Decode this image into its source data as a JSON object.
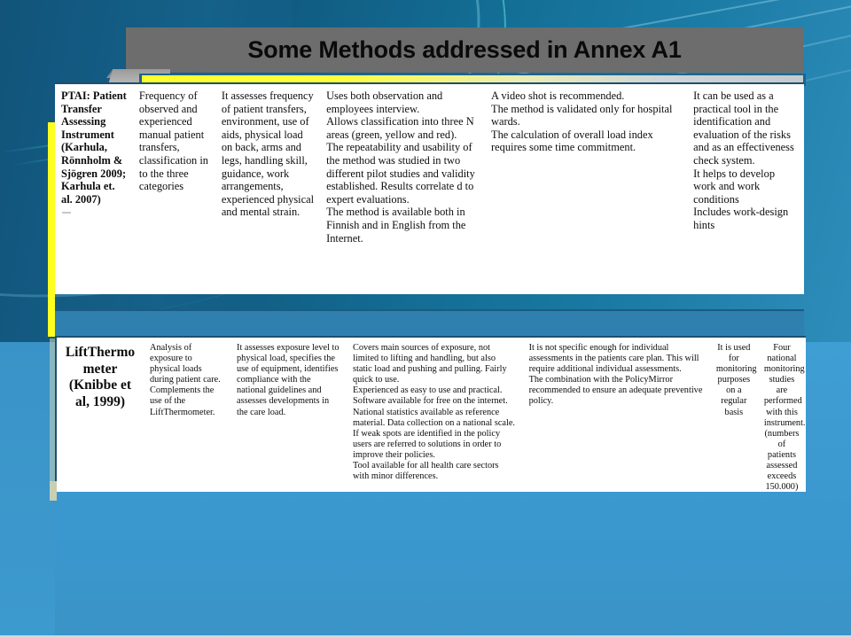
{
  "slide": {
    "title": "Some Methods addressed in Annex A1",
    "accent_color": "#ffff1f",
    "banner_color": "#6d6d6d",
    "background_top_color": "#10567c",
    "background_bottom_color": "#3c9cd2"
  },
  "tables": [
    {
      "id": "table-ptai",
      "rows": [
        {
          "method": "PTAI: Patient Transfer Assessing Instrument (Karhula, Rönnholm & Sjögren 2009; Karhula et. al. 2007)",
          "purpose": "Frequency of observed and experienced manual patient transfers, classification in to the three categories",
          "assesses": "It assesses frequency of patient transfers, environment, use of aids, physical load on back, arms and legs, handling skill, guidance, work arrangements, experienced physical and mental strain.",
          "strengths": [
            "Uses both observation and employees interview.",
            "Allows classification into three N areas (green, yellow and red).",
            "The repeatability and usability of the method was studied in two different pilot studies and validity established.  Results correlate d to expert evaluations.",
            "The method is available both in Finnish and in English from the Internet."
          ],
          "limitations": [
            "A video shot is recommended.",
            "The method is validated only for hospital wards.",
            "The calculation of overall load index requires some time commitment."
          ],
          "use": [
            "It can be used as a practical tool in the identification and evaluation of the risks and as an effectiveness check system.",
            "It helps to develop work and work conditions",
            "Includes work-design hints"
          ]
        }
      ]
    },
    {
      "id": "table-liftthermo",
      "rows": [
        {
          "method": "LiftThermo meter (Knibbe et al, 1999)",
          "purpose": [
            "Analysis of exposure to physical loads during patient care.",
            "Complements the use of the LiftThermometer."
          ],
          "assesses": "It assesses exposure level to physical load,  specifies the use of equipment, identifies compliance with the national guidelines and assesses developments in the care load.",
          "strengths": [
            "Covers main sources of exposure, not limited to lifting and handling, but also static load and pushing and pulling. Fairly quick to use.",
            "Experienced as easy to use and practical. Software available for free on the internet. National statistics available as reference material. Data collection on a national scale.",
            "If weak spots are identified in the policy users are referred to solutions in order to improve their policies.",
            "Tool available for all health care sectors with minor differences."
          ],
          "limitations": [
            "It is not specific enough for individual assessments in the patients care plan. This will require additional individual assessments.",
            "The combination with the PolicyMirror recommended to ensure an adequate preventive policy."
          ],
          "use": "It is used for monitoring purposes on a regular basis",
          "extra": "Four national monitoring studies are performed with this instrument. (numbers of patients assessed exceeds 150.000)"
        }
      ]
    }
  ]
}
